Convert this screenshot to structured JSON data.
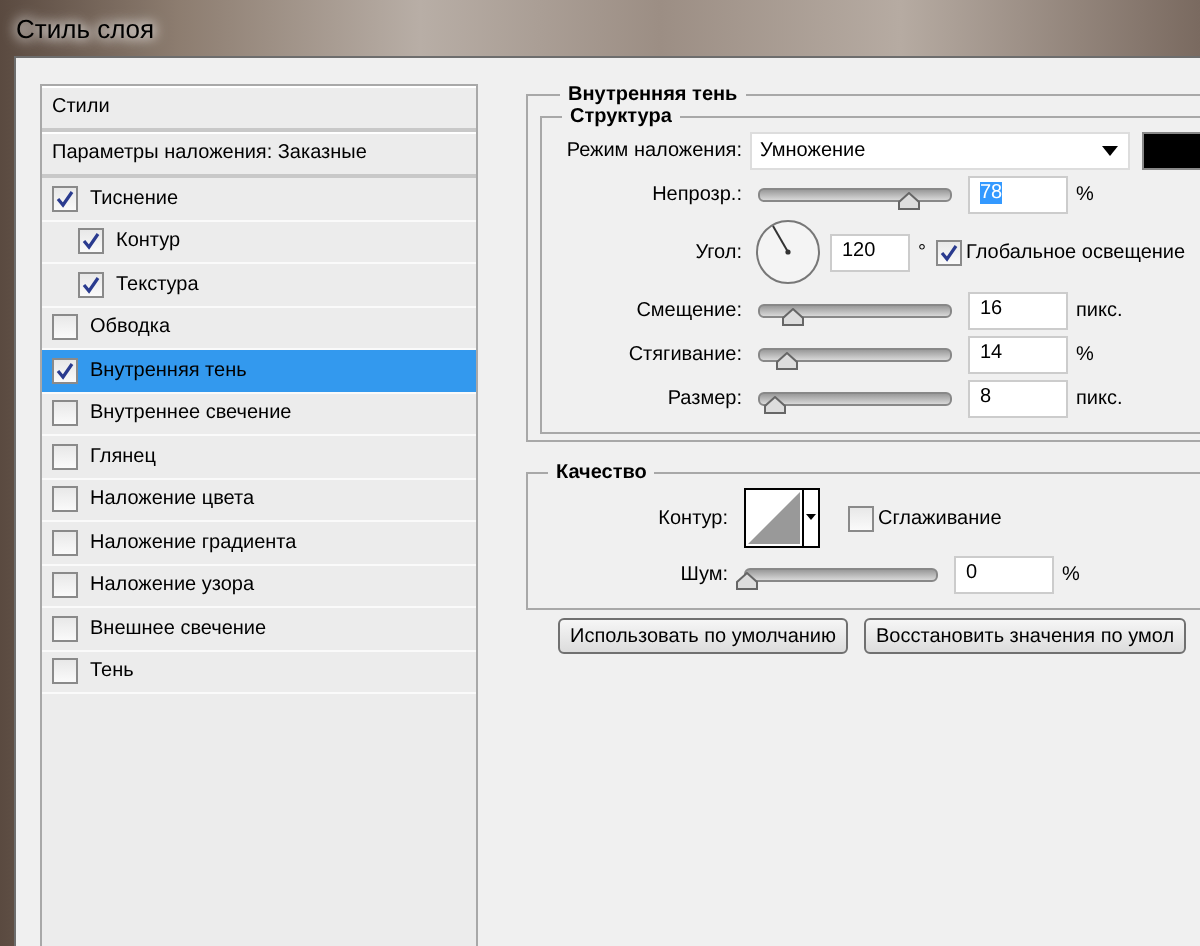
{
  "window": {
    "title": "Стиль слоя"
  },
  "styles_panel": {
    "header": "Стили",
    "blending": "Параметры наложения: Заказные",
    "items": [
      {
        "label": "Тиснение",
        "checked": true,
        "selected": false,
        "children": [
          {
            "label": "Контур",
            "checked": true,
            "selected": false
          },
          {
            "label": "Текстура",
            "checked": true,
            "selected": false
          }
        ]
      },
      {
        "label": "Обводка",
        "checked": false,
        "selected": false
      },
      {
        "label": "Внутренняя тень",
        "checked": true,
        "selected": true
      },
      {
        "label": "Внутреннее свечение",
        "checked": false,
        "selected": false
      },
      {
        "label": "Глянец",
        "checked": false,
        "selected": false
      },
      {
        "label": "Наложение цвета",
        "checked": false,
        "selected": false
      },
      {
        "label": "Наложение градиента",
        "checked": false,
        "selected": false
      },
      {
        "label": "Наложение узора",
        "checked": false,
        "selected": false
      },
      {
        "label": "Внешнее свечение",
        "checked": false,
        "selected": false
      },
      {
        "label": "Тень",
        "checked": false,
        "selected": false
      }
    ]
  },
  "inner_shadow": {
    "title": "Внутренняя тень",
    "structure": {
      "title": "Структура",
      "blend_mode": {
        "label": "Режим наложения:",
        "value": "Умножение",
        "color": "#000000"
      },
      "opacity": {
        "label": "Непрозр.:",
        "level": 0.78,
        "value": "78",
        "unit": "%"
      },
      "angle": {
        "label": "Угол:",
        "value": "120",
        "unit": "°",
        "global_light": {
          "label": "Глобальное освещение",
          "checked": true
        }
      },
      "sliders": [
        {
          "label": "Смещение:",
          "level": 0.17,
          "value": "16",
          "unit": "пикс."
        },
        {
          "label": "Стягивание:",
          "level": 0.14,
          "value": "14",
          "unit": "%"
        },
        {
          "label": "Размер:",
          "level": 0.07,
          "value": "8",
          "unit": "пикс."
        }
      ]
    },
    "quality": {
      "title": "Качество",
      "contour_label": "Контур:",
      "antialias": {
        "label": "Сглаживание",
        "checked": false
      },
      "noise": {
        "label": "Шум:",
        "level": 0,
        "value": "0",
        "unit": "%"
      }
    }
  },
  "buttons": [
    "Использовать по умолчанию",
    "Восстановить значения по умол"
  ]
}
